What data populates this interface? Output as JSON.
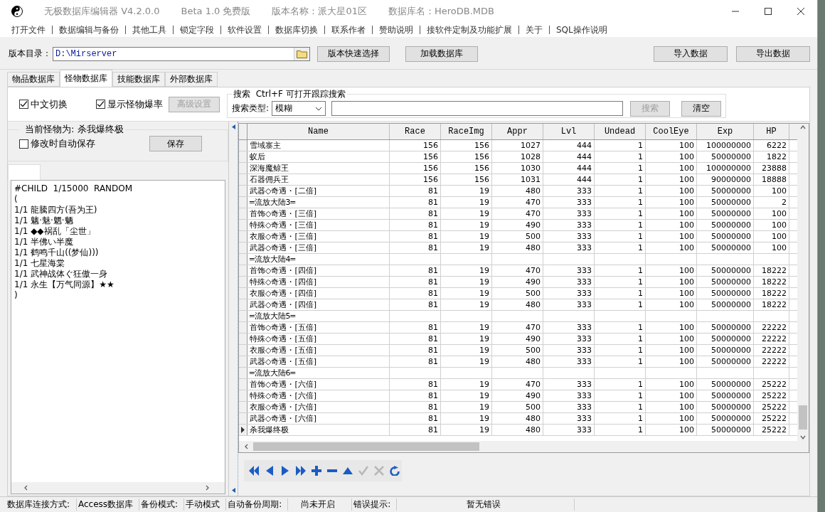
{
  "window": {
    "title_parts": [
      "无极数据库编辑器 V4.2.0.0",
      "Beta 1.0 免费版",
      "版本名称：派大星01区",
      "数据库名：HeroDB.MDB"
    ]
  },
  "menu": [
    "打开文件",
    "数据编辑与备份",
    "其他工具",
    "锁定字段",
    "软件设置",
    "数据库切换",
    "联系作者",
    "赞助说明",
    "接软件定制及功能扩展",
    "关于",
    "SQL操作说明"
  ],
  "toolbar": {
    "path_label": "版本目录：",
    "path_value": "D:\\Mirserver",
    "left_buttons": [
      "版本快速选择",
      "加载数据库"
    ],
    "right_buttons": [
      "导入数据",
      "导出数据"
    ]
  },
  "tabs": [
    {
      "label": "物品数据库",
      "selected": false
    },
    {
      "label": "怪物数据库",
      "selected": true
    },
    {
      "label": "技能数据库",
      "selected": false
    },
    {
      "label": "外部数据库",
      "selected": false
    }
  ],
  "options": {
    "checkboxes": [
      {
        "label": "中文切换",
        "checked": true
      },
      {
        "label": "显示怪物爆率",
        "checked": true
      }
    ],
    "advanced_button": {
      "label": "高级设置",
      "disabled": true
    }
  },
  "search": {
    "title": "搜索  Ctrl+F 可打开跟踪搜索",
    "type_label": "搜索类型:",
    "type_value": "模糊",
    "search_button": {
      "label": "搜索",
      "disabled": true
    },
    "clear_button": "清空"
  },
  "monster_panel": {
    "title": "当前怪物为: 杀我爆终极",
    "autosave": {
      "label": "修改时自动保存",
      "checked": false
    },
    "save_button": "保存",
    "editor_lines": [
      "#CHILD  1/15000  RANDOM",
      "(",
      "1/1 龍騰四方(吾为王)",
      "1/1 魑·魅·魍·魉",
      "1/1 ◆◆祸乱「尘世」",
      "1/1 半佛い半魔",
      "1/1 鹤鸣千山((梦仙)))",
      "1/1 七星海棠",
      "1/1 武神战体ぐ狂傲一身",
      "1/1 永生【万气同源】★★",
      ")"
    ]
  },
  "table": {
    "columns": [
      "Name",
      "Race",
      "RaceImg",
      "Appr",
      "Lvl",
      "Undead",
      "CoolEye",
      "Exp",
      "HP"
    ],
    "rows": [
      {
        "kind": "record",
        "selected": false,
        "cells": [
          "雪域寨主",
          "156",
          "156",
          "1027",
          "444",
          "1",
          "100",
          "100000000",
          "6222"
        ]
      },
      {
        "kind": "record",
        "selected": false,
        "cells": [
          "蚁后",
          "156",
          "156",
          "1028",
          "444",
          "1",
          "100",
          "50000000",
          "1822"
        ]
      },
      {
        "kind": "record",
        "selected": false,
        "cells": [
          "深海魔鲸王",
          "156",
          "156",
          "1030",
          "444",
          "1",
          "100",
          "100000000",
          "23888"
        ]
      },
      {
        "kind": "record",
        "selected": false,
        "cells": [
          "石器佣兵王",
          "156",
          "156",
          "1031",
          "444",
          "1",
          "100",
          "90000000",
          "18888"
        ]
      },
      {
        "kind": "record",
        "selected": false,
        "cells": [
          "武器◇奇遇・[二倍]",
          "81",
          "19",
          "480",
          "333",
          "1",
          "100",
          "50000000",
          "100"
        ]
      },
      {
        "kind": "record",
        "selected": false,
        "cells": [
          "═流放大陆3═",
          "81",
          "19",
          "470",
          "333",
          "1",
          "100",
          "50000000",
          "2"
        ]
      },
      {
        "kind": "record",
        "selected": false,
        "cells": [
          "首饰◇奇遇・[三倍]",
          "81",
          "19",
          "470",
          "333",
          "1",
          "100",
          "50000000",
          "100"
        ]
      },
      {
        "kind": "record",
        "selected": false,
        "cells": [
          "特殊◇奇遇・[三倍]",
          "81",
          "19",
          "490",
          "333",
          "1",
          "100",
          "50000000",
          "100"
        ]
      },
      {
        "kind": "record",
        "selected": false,
        "cells": [
          "衣服◇奇遇・[三倍]",
          "81",
          "19",
          "500",
          "333",
          "1",
          "100",
          "50000000",
          "100"
        ]
      },
      {
        "kind": "record",
        "selected": false,
        "cells": [
          "武器◇奇遇・[三倍]",
          "81",
          "19",
          "480",
          "333",
          "1",
          "100",
          "50000000",
          "100"
        ]
      },
      {
        "kind": "group",
        "selected": false,
        "cells": [
          "═流放大陆4═"
        ]
      },
      {
        "kind": "record",
        "selected": false,
        "cells": [
          "首饰◇奇遇・[四倍]",
          "81",
          "19",
          "470",
          "333",
          "1",
          "100",
          "50000000",
          "18222"
        ]
      },
      {
        "kind": "record",
        "selected": false,
        "cells": [
          "特殊◇奇遇・[四倍]",
          "81",
          "19",
          "490",
          "333",
          "1",
          "100",
          "50000000",
          "18222"
        ]
      },
      {
        "kind": "record",
        "selected": false,
        "cells": [
          "衣服◇奇遇・[四倍]",
          "81",
          "19",
          "500",
          "333",
          "1",
          "100",
          "50000000",
          "18222"
        ]
      },
      {
        "kind": "record",
        "selected": false,
        "cells": [
          "武器◇奇遇・[四倍]",
          "81",
          "19",
          "480",
          "333",
          "1",
          "100",
          "50000000",
          "18222"
        ]
      },
      {
        "kind": "group",
        "selected": false,
        "cells": [
          "═流放大陆5═"
        ]
      },
      {
        "kind": "record",
        "selected": false,
        "cells": [
          "首饰◇奇遇・[五倍]",
          "81",
          "19",
          "470",
          "333",
          "1",
          "100",
          "50000000",
          "22222"
        ]
      },
      {
        "kind": "record",
        "selected": false,
        "cells": [
          "特殊◇奇遇・[五倍]",
          "81",
          "19",
          "490",
          "333",
          "1",
          "100",
          "50000000",
          "22222"
        ]
      },
      {
        "kind": "record",
        "selected": false,
        "cells": [
          "衣服◇奇遇・[五倍]",
          "81",
          "19",
          "500",
          "333",
          "1",
          "100",
          "50000000",
          "22222"
        ]
      },
      {
        "kind": "record",
        "selected": false,
        "cells": [
          "武器◇奇遇・[五倍]",
          "81",
          "19",
          "480",
          "333",
          "1",
          "100",
          "50000000",
          "22222"
        ]
      },
      {
        "kind": "group",
        "selected": false,
        "cells": [
          "═流放大陆6═"
        ]
      },
      {
        "kind": "record",
        "selected": false,
        "cells": [
          "首饰◇奇遇・[六倍]",
          "81",
          "19",
          "470",
          "333",
          "1",
          "100",
          "50000000",
          "25222"
        ]
      },
      {
        "kind": "record",
        "selected": false,
        "cells": [
          "特殊◇奇遇・[六倍]",
          "81",
          "19",
          "490",
          "333",
          "1",
          "100",
          "50000000",
          "25222"
        ]
      },
      {
        "kind": "record",
        "selected": false,
        "cells": [
          "衣服◇奇遇・[六倍]",
          "81",
          "19",
          "500",
          "333",
          "1",
          "100",
          "50000000",
          "25222"
        ]
      },
      {
        "kind": "record",
        "selected": false,
        "cells": [
          "武器◇奇遇・[六倍]",
          "81",
          "19",
          "480",
          "333",
          "1",
          "100",
          "50000000",
          "25222"
        ]
      },
      {
        "kind": "record",
        "selected": true,
        "cells": [
          "杀我爆终极",
          "81",
          "19",
          "480",
          "333",
          "1",
          "100",
          "50000000",
          "25222"
        ]
      }
    ]
  },
  "navigator": [
    {
      "kind": "first",
      "disabled": false
    },
    {
      "kind": "prior",
      "disabled": false
    },
    {
      "kind": "next",
      "disabled": false
    },
    {
      "kind": "last",
      "disabled": false
    },
    {
      "kind": "insert",
      "disabled": false
    },
    {
      "kind": "delete",
      "disabled": false
    },
    {
      "kind": "edit",
      "disabled": false
    },
    {
      "kind": "post",
      "disabled": true
    },
    {
      "kind": "cancel",
      "disabled": true
    },
    {
      "kind": "refresh",
      "disabled": false
    }
  ],
  "status_bar": [
    "数据库连接方式:",
    "Access数据库",
    "备份模式:",
    "手动模式",
    "自动备份周期:",
    "尚未开启",
    "错误提示:",
    "暂无错误"
  ]
}
